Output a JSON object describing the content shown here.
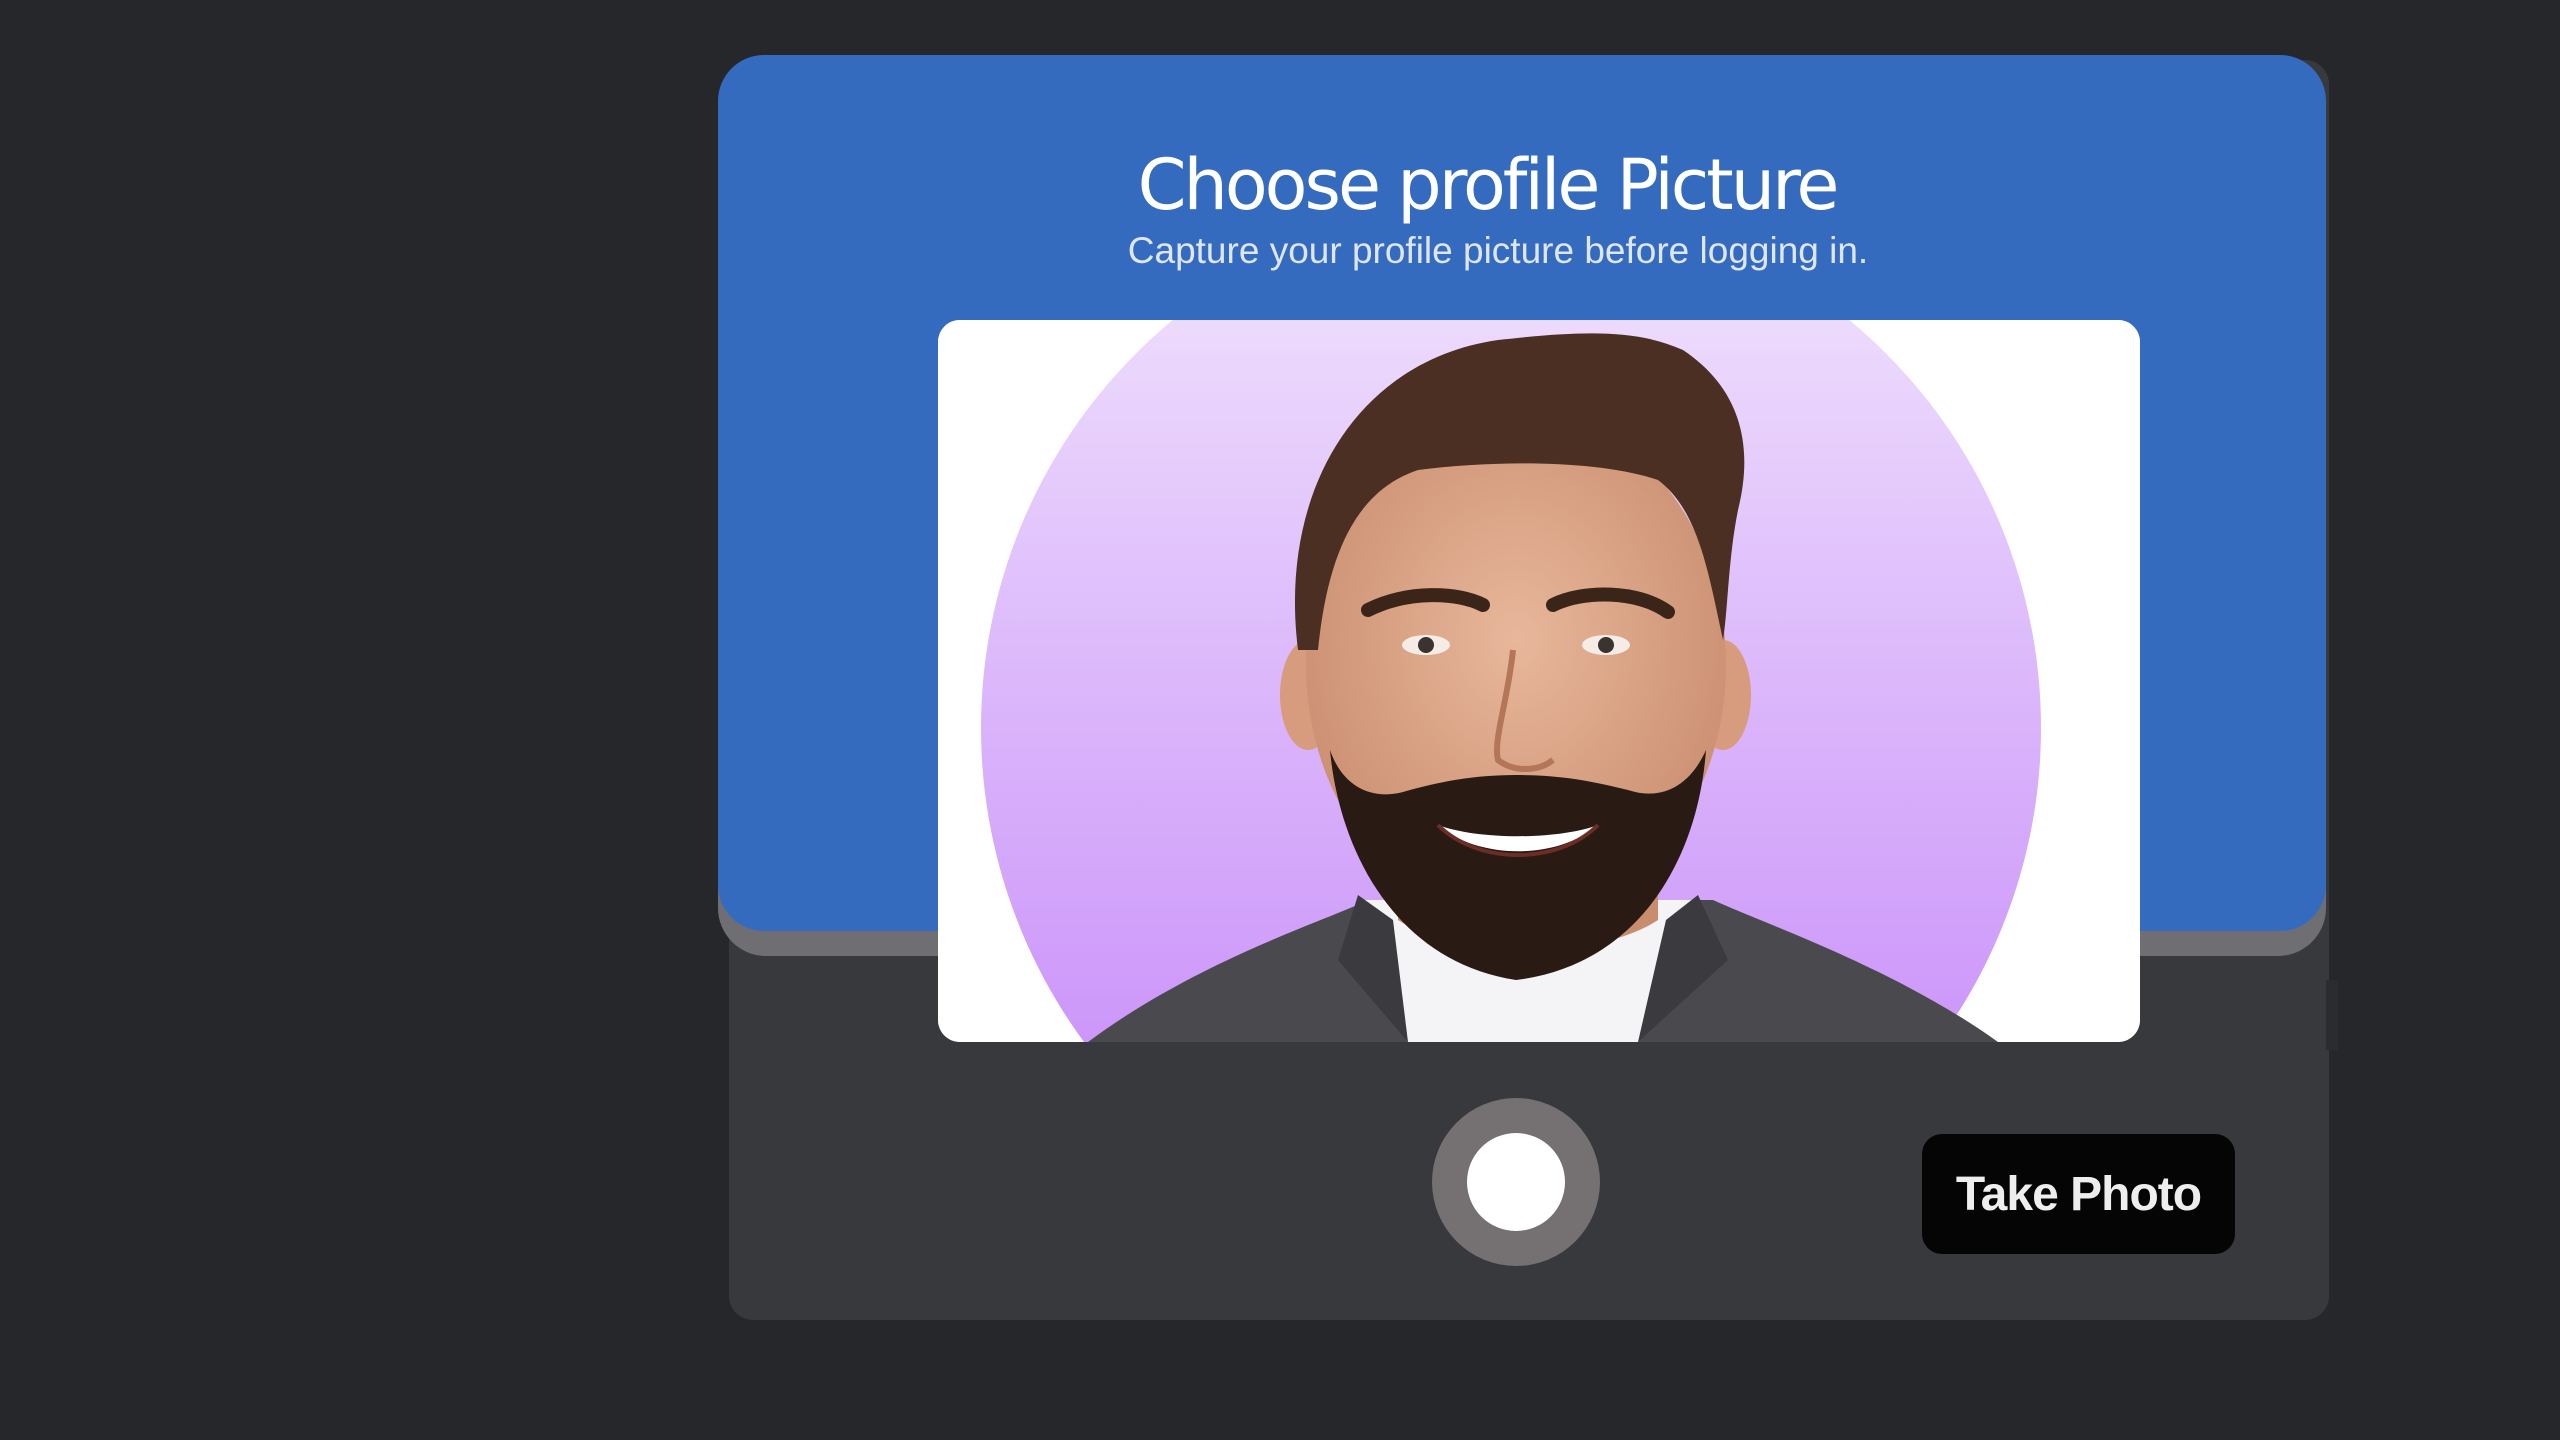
{
  "dialog": {
    "title": "Choose profile  Picture",
    "subtitle": "Capture your profile picture before logging in."
  },
  "preview": {
    "image_label": "profile-photo-preview"
  },
  "controls": {
    "shutter_icon": "shutter-icon",
    "take_photo_label": "Take Photo"
  },
  "colors": {
    "background": "#26272b",
    "header": "#356bbf",
    "panel": "#38393d",
    "button": "#050505",
    "avatar_gradient_top": "#f2e6fd",
    "avatar_gradient_bottom": "#c383f9"
  }
}
